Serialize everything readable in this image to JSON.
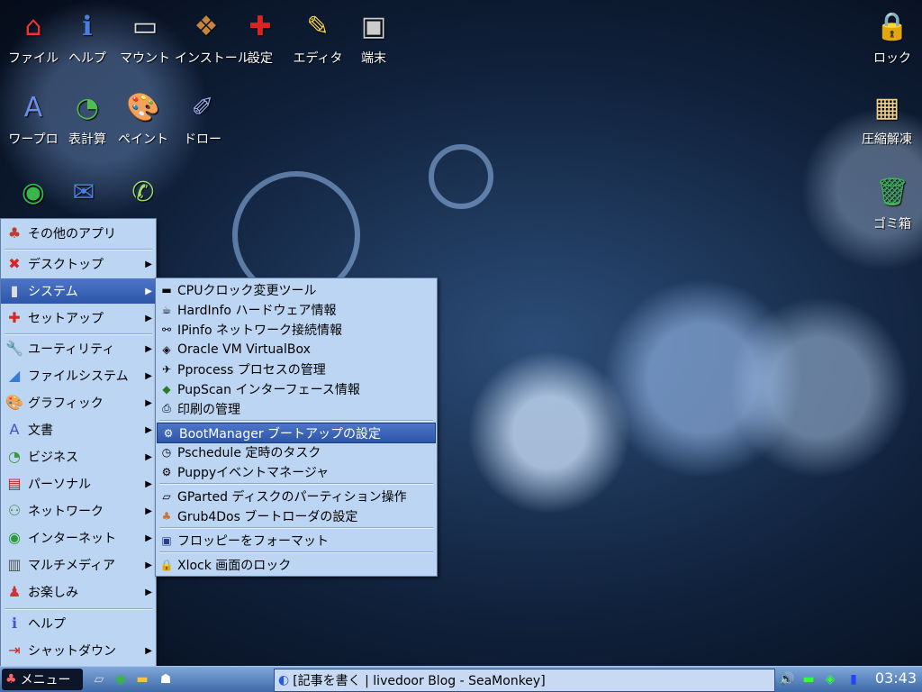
{
  "desktop_icons": [
    {
      "label": "ファイル",
      "icon": "home-icon"
    },
    {
      "label": "ヘルプ",
      "icon": "help-icon"
    },
    {
      "label": "マウント",
      "icon": "drive-icon"
    },
    {
      "label": "インストール",
      "icon": "install-icon"
    },
    {
      "label": "設定",
      "icon": "settings-icon"
    },
    {
      "label": "エディタ",
      "icon": "editor-icon"
    },
    {
      "label": "端末",
      "icon": "terminal-icon"
    },
    {
      "label": "ロック",
      "icon": "lock-icon"
    },
    {
      "label": "ワープロ",
      "icon": "wordprocessor-icon"
    },
    {
      "label": "表計算",
      "icon": "spreadsheet-icon"
    },
    {
      "label": "ペイント",
      "icon": "paint-icon"
    },
    {
      "label": "ドロー",
      "icon": "draw-icon"
    },
    {
      "label": "圧縮解凍",
      "icon": "archive-icon"
    },
    {
      "label": "ゴミ箱",
      "icon": "trash-icon"
    },
    {
      "label": "",
      "icon": "browser-globe-icon"
    },
    {
      "label": "",
      "icon": "mail-icon"
    },
    {
      "label": "",
      "icon": "chat-icon"
    }
  ],
  "main_menu": [
    {
      "label": "その他のアプリ",
      "icon": "other-apps-icon",
      "submenu": false
    },
    {
      "label": "デスクトップ",
      "icon": "desktop-icon",
      "submenu": true
    },
    {
      "label": "システム",
      "icon": "system-icon",
      "submenu": true,
      "selected": true
    },
    {
      "label": "セットアップ",
      "icon": "setup-icon",
      "submenu": true
    },
    {
      "label": "ユーティリティ",
      "icon": "utility-icon",
      "submenu": true
    },
    {
      "label": "ファイルシステム",
      "icon": "filesystem-icon",
      "submenu": true
    },
    {
      "label": "グラフィック",
      "icon": "graphics-icon",
      "submenu": true
    },
    {
      "label": "文書",
      "icon": "document-icon",
      "submenu": true
    },
    {
      "label": "ビジネス",
      "icon": "business-icon",
      "submenu": true
    },
    {
      "label": "パーソナル",
      "icon": "calendar-icon",
      "submenu": true
    },
    {
      "label": "ネットワーク",
      "icon": "network-icon",
      "submenu": true
    },
    {
      "label": "インターネット",
      "icon": "internet-icon",
      "submenu": true
    },
    {
      "label": "マルチメディア",
      "icon": "multimedia-icon",
      "submenu": true
    },
    {
      "label": "お楽しみ",
      "icon": "fun-icon",
      "submenu": true
    },
    {
      "label": "ヘルプ",
      "icon": "help-icon",
      "submenu": false
    },
    {
      "label": "シャットダウン",
      "icon": "shutdown-icon",
      "submenu": true
    }
  ],
  "system_submenu": [
    {
      "label": "CPUクロック変更ツール",
      "icon": "cpu-icon"
    },
    {
      "label": "HardInfo ハードウェア情報",
      "icon": "hardinfo-icon"
    },
    {
      "label": "IPinfo ネットワーク接続情報",
      "icon": "ipinfo-icon"
    },
    {
      "label": "Oracle VM VirtualBox",
      "icon": "virtualbox-icon"
    },
    {
      "label": "Pprocess プロセスの管理",
      "icon": "process-icon"
    },
    {
      "label": "PupScan インターフェース情報",
      "icon": "pupscan-icon"
    },
    {
      "label": "印刷の管理",
      "icon": "printer-icon"
    },
    {
      "label": "BootManager ブートアップの設定",
      "icon": "bootmanager-icon",
      "selected": true
    },
    {
      "label": "Pschedule 定時のタスク",
      "icon": "clock-icon"
    },
    {
      "label": "Puppyイベントマネージャ",
      "icon": "event-icon"
    },
    {
      "label": "GParted ディスクのパーティション操作",
      "icon": "gparted-icon"
    },
    {
      "label": "Grub4Dos ブートローダの設定",
      "icon": "grub-icon"
    },
    {
      "label": "フロッピーをフォーマット",
      "icon": "floppy-icon"
    },
    {
      "label": "Xlock 画面のロック",
      "icon": "padlock-icon"
    }
  ],
  "taskbar": {
    "start_label": "メニュー",
    "task_title": "[記事を書く | livedoor Blog - SeaMonkey]",
    "clock": "03:43"
  }
}
